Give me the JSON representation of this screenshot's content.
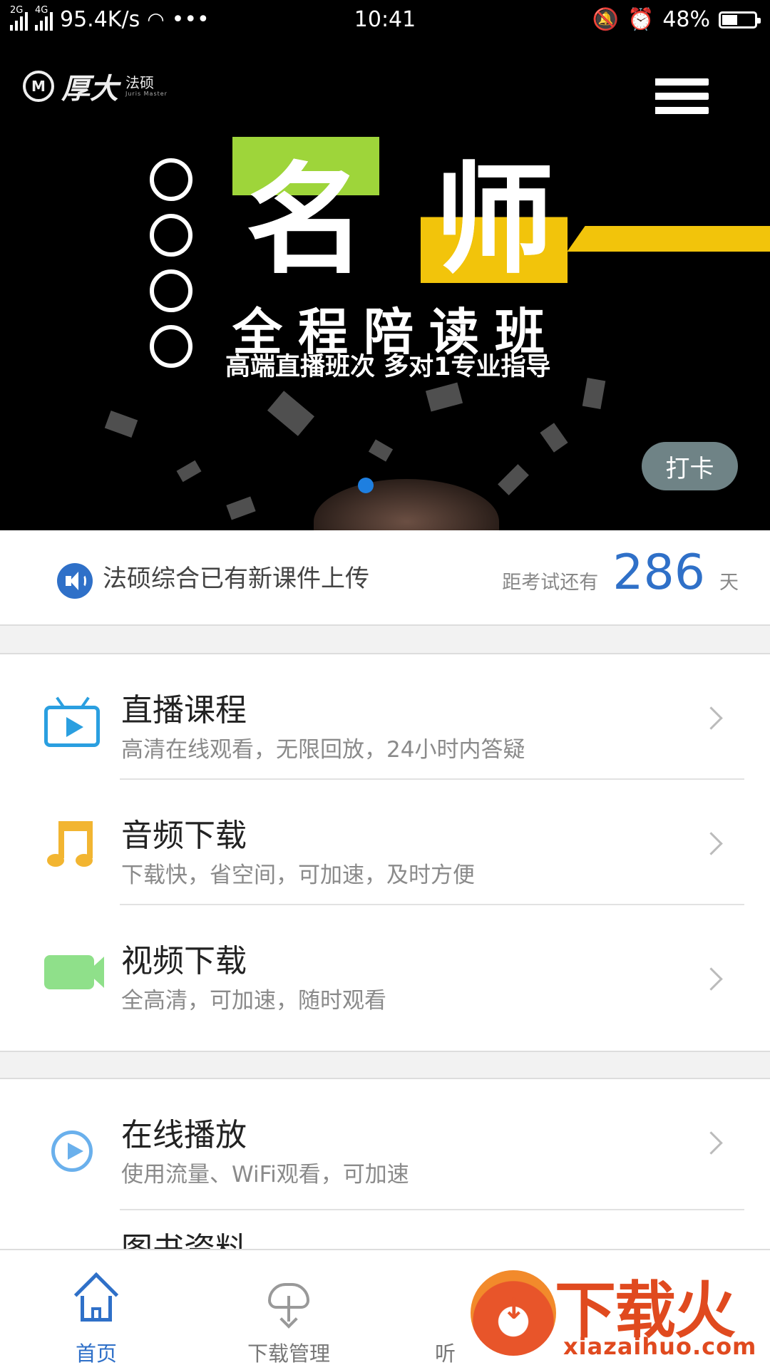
{
  "status_bar": {
    "net_tag_1": "2G",
    "net_tag_2": "4G",
    "speed": "95.4K/s",
    "dots": "•••",
    "time": "10:41",
    "battery": "48%",
    "battery_level": 0.48
  },
  "banner": {
    "brand": "厚大",
    "brand_sub": "法硕",
    "brand_en": "Juris Master",
    "headline_char_1": "名",
    "headline_char_2": "师",
    "title": "全程陪读班",
    "subtitle": "高端直播班次 多对1专业指导",
    "checkin_label": "打卡"
  },
  "notice": {
    "text": "法硕综合已有新课件上传",
    "countdown_label": "距考试还有",
    "countdown_days": "286",
    "countdown_unit": "天"
  },
  "section1": [
    {
      "title": "直播课程",
      "desc": "高清在线观看，无限回放，24小时内答疑",
      "icon": "live-tv-icon"
    },
    {
      "title": "音频下载",
      "desc": "下载快，省空间，可加速，及时方便",
      "icon": "music-note-icon"
    },
    {
      "title": "视频下载",
      "desc": "全高清，可加速，随时观看",
      "icon": "video-camera-icon"
    }
  ],
  "section2": [
    {
      "title": "在线播放",
      "desc": "使用流量、WiFi观看，可加速",
      "icon": "play-circle-icon"
    },
    {
      "title": "图书资料",
      "desc": "",
      "icon": ""
    }
  ],
  "tabbar": {
    "home": "首页",
    "downloads": "下载管理",
    "listen": "听"
  },
  "watermark": {
    "text": "下载火",
    "url": "xiazaihuo.com"
  },
  "colors": {
    "accent": "#2f70c8",
    "green": "#9ed53a",
    "yellow": "#f2c40b"
  }
}
